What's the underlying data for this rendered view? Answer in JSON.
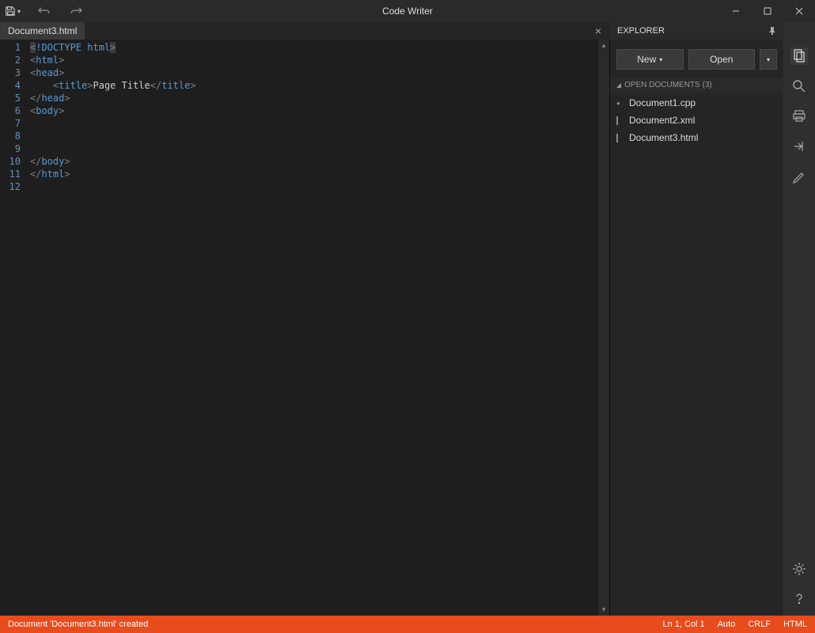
{
  "app": {
    "title": "Code Writer"
  },
  "tab": {
    "name": "Document3.html"
  },
  "editor": {
    "line_count": 12,
    "lines": [
      {
        "tokens": [
          {
            "t": "<",
            "c": "bracket",
            "sel": true
          },
          {
            "t": "!DOCTYPE html",
            "c": "tag"
          },
          {
            "t": ">",
            "c": "bracket",
            "sel": true
          }
        ]
      },
      {
        "tokens": [
          {
            "t": "<",
            "c": "bracket"
          },
          {
            "t": "html",
            "c": "tag"
          },
          {
            "t": ">",
            "c": "bracket"
          }
        ]
      },
      {
        "tokens": [
          {
            "t": "<",
            "c": "bracket"
          },
          {
            "t": "head",
            "c": "tag"
          },
          {
            "t": ">",
            "c": "bracket"
          }
        ]
      },
      {
        "tokens": [
          {
            "t": "    ",
            "c": "text"
          },
          {
            "t": "<",
            "c": "bracket"
          },
          {
            "t": "title",
            "c": "tag"
          },
          {
            "t": ">",
            "c": "bracket"
          },
          {
            "t": "Page Title",
            "c": "text"
          },
          {
            "t": "</",
            "c": "bracket"
          },
          {
            "t": "title",
            "c": "tag"
          },
          {
            "t": ">",
            "c": "bracket"
          }
        ]
      },
      {
        "tokens": [
          {
            "t": "</",
            "c": "bracket"
          },
          {
            "t": "head",
            "c": "tag"
          },
          {
            "t": ">",
            "c": "bracket"
          }
        ]
      },
      {
        "tokens": [
          {
            "t": "<",
            "c": "bracket"
          },
          {
            "t": "body",
            "c": "tag"
          },
          {
            "t": ">",
            "c": "bracket"
          }
        ]
      },
      {
        "tokens": [
          {
            "t": "",
            "c": "text"
          }
        ]
      },
      {
        "tokens": [
          {
            "t": "",
            "c": "text"
          }
        ]
      },
      {
        "tokens": [
          {
            "t": "",
            "c": "text"
          }
        ]
      },
      {
        "tokens": [
          {
            "t": "</",
            "c": "bracket"
          },
          {
            "t": "body",
            "c": "tag"
          },
          {
            "t": ">",
            "c": "bracket"
          }
        ]
      },
      {
        "tokens": [
          {
            "t": "</",
            "c": "bracket"
          },
          {
            "t": "html",
            "c": "tag"
          },
          {
            "t": ">",
            "c": "bracket"
          }
        ]
      },
      {
        "tokens": [
          {
            "t": "",
            "c": "text"
          }
        ]
      }
    ]
  },
  "explorer": {
    "title": "EXPLORER",
    "new_label": "New",
    "open_label": "Open",
    "open_docs_label": "OPEN DOCUMENTS (3)",
    "files": [
      {
        "name": "Document1.cpp",
        "dirty": true
      },
      {
        "name": "Document2.xml",
        "dirty": false
      },
      {
        "name": "Document3.html",
        "dirty": false
      }
    ]
  },
  "statusbar": {
    "message": "Document 'Document3.html' created",
    "position": "Ln 1, Col 1",
    "indent": "Auto",
    "eol": "CRLF",
    "lang": "HTML"
  }
}
